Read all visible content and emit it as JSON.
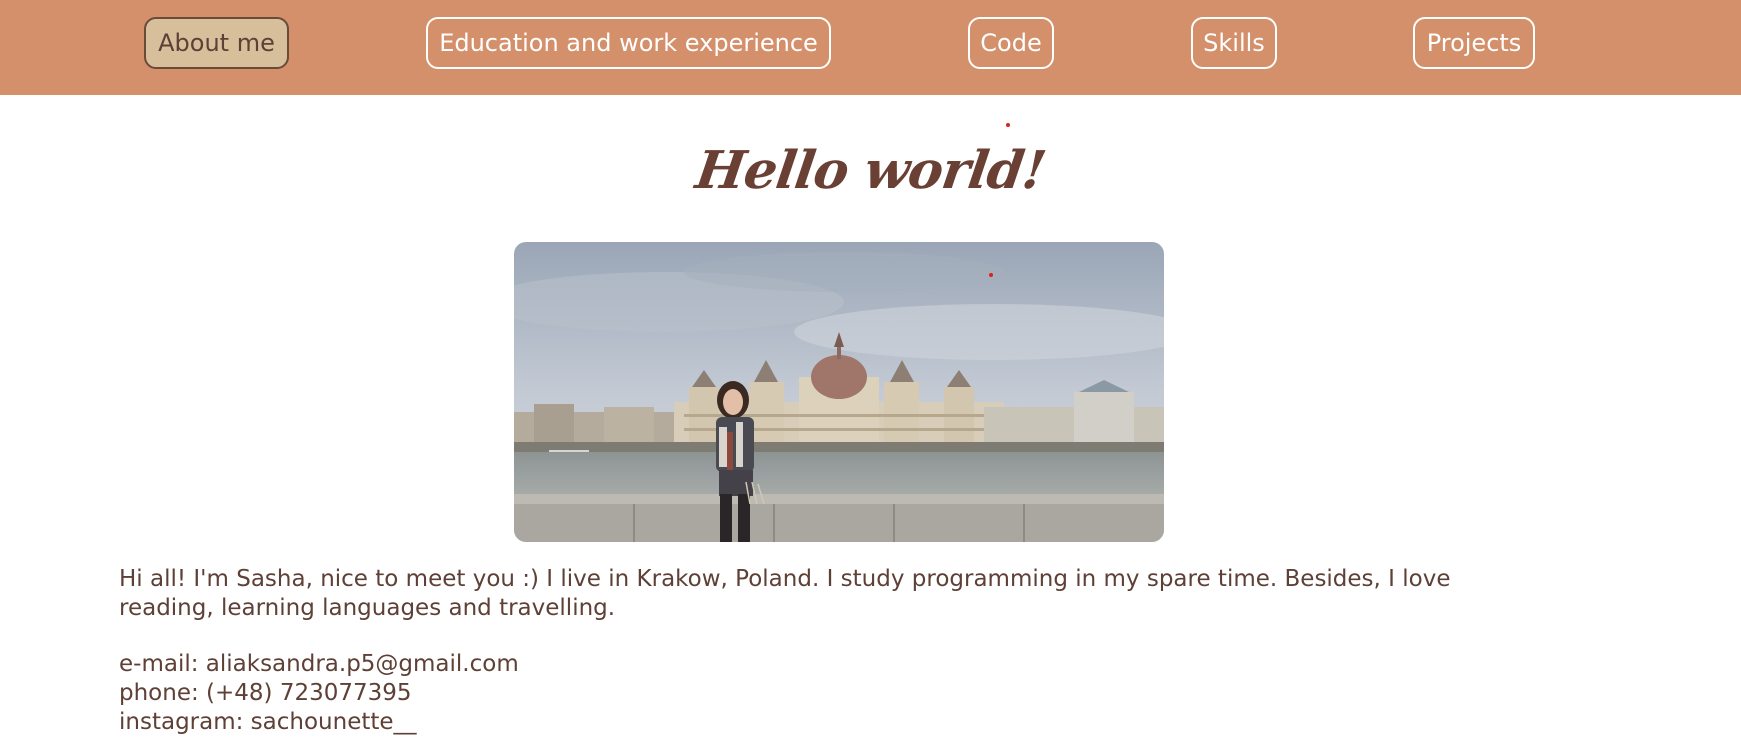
{
  "nav": {
    "items": [
      {
        "label": "About me",
        "active": true
      },
      {
        "label": "Education and work experience",
        "active": false
      },
      {
        "label": "Code",
        "active": false
      },
      {
        "label": "Skills",
        "active": false
      },
      {
        "label": "Projects",
        "active": false
      }
    ]
  },
  "main": {
    "title": "Hello world!",
    "about_text": "Hi all! I'm Sasha, nice to meet you :) I live in Krakow, Poland. I study programming in my spare time. Besides, I love reading, learning languages and travelling.",
    "contacts": {
      "email": "e-mail: aliaksandra.p5@gmail.com",
      "phone": "phone: (+48) 723077395",
      "instagram": "instagram: sachounette__"
    }
  },
  "colors": {
    "navbar": "#d48f6b",
    "active_button": "#d8bf9c",
    "text": "#5e4036"
  }
}
